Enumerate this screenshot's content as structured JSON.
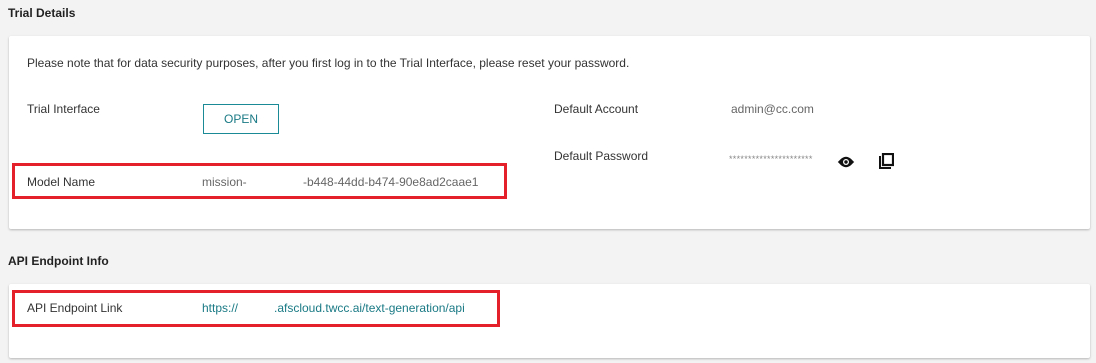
{
  "trial_details": {
    "title": "Trial Details",
    "notice": "Please note that for data security purposes, after you first log in to the Trial Interface, please reset your password.",
    "trial_interface_label": "Trial Interface",
    "open_button_label": "OPEN",
    "model_name_label": "Model Name",
    "model_name_prefix": "mission-",
    "model_name_suffix": "-b448-44dd-b474-90e8ad2caae1",
    "default_account_label": "Default Account",
    "default_account_value": "admin@cc.com",
    "default_password_label": "Default Password",
    "default_password_masked": "**********************"
  },
  "api_endpoint": {
    "title": "API Endpoint Info",
    "link_label": "API Endpoint Link",
    "link_prefix": "https://",
    "link_suffix": ".afscloud.twcc.ai/text-generation/api"
  },
  "colors": {
    "accent": "#1a7a85",
    "highlight": "#e4212b",
    "background": "#f3f3f3"
  },
  "icons": [
    "eye-icon",
    "copy-icon"
  ]
}
